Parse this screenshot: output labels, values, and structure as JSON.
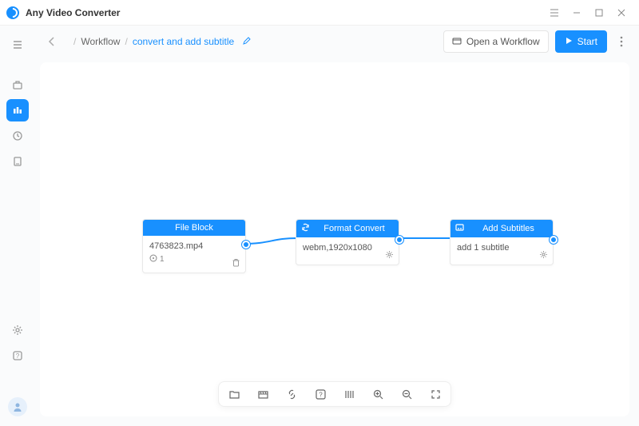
{
  "app": {
    "title": "Any Video Converter"
  },
  "breadcrumb": {
    "root": "Workflow",
    "current": "convert and add subtitle"
  },
  "actions": {
    "open": "Open a Workflow",
    "start": "Start"
  },
  "nodes": {
    "file_block": {
      "title": "File Block",
      "filename": "4763823.mp4",
      "count": "1"
    },
    "format_convert": {
      "title": "Format Convert",
      "detail": "webm,1920x1080"
    },
    "add_subtitles": {
      "title": "Add Subtitles",
      "detail": "add 1 subtitle"
    }
  }
}
